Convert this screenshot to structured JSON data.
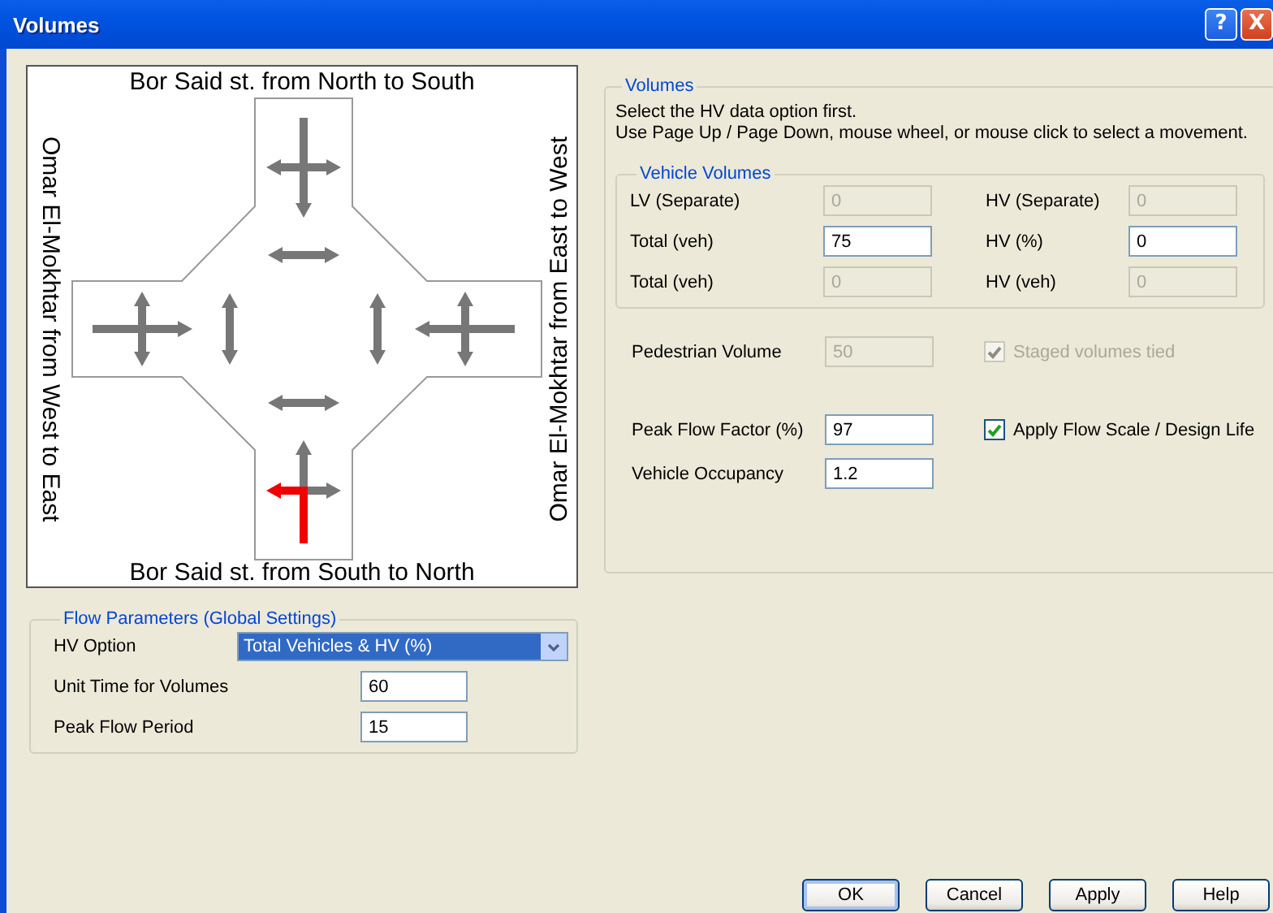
{
  "window": {
    "title": "Volumes",
    "help_button": "?",
    "close_button": "X"
  },
  "diagram": {
    "labels": {
      "top": "Bor Said st. from North to South",
      "bottom": "Bor Said st. from South to North",
      "left": "Omar El-Mokhtar from West to East",
      "right": "Omar El-Mokhtar from East to West"
    },
    "approaches": [
      {
        "kind": "north",
        "movements": [
          {
            "kind": "left",
            "selected": false
          },
          {
            "kind": "through",
            "selected": false
          },
          {
            "kind": "right",
            "selected": false
          }
        ]
      },
      {
        "kind": "west",
        "movements": [
          {
            "kind": "left",
            "selected": false
          },
          {
            "kind": "through",
            "selected": false
          },
          {
            "kind": "right",
            "selected": false
          }
        ]
      },
      {
        "kind": "east",
        "movements": [
          {
            "kind": "left",
            "selected": false
          },
          {
            "kind": "through",
            "selected": false
          },
          {
            "kind": "right",
            "selected": false
          }
        ]
      },
      {
        "kind": "south",
        "movements": [
          {
            "kind": "left",
            "selected": true
          },
          {
            "kind": "through",
            "selected": false
          },
          {
            "kind": "right",
            "selected": false
          }
        ]
      }
    ],
    "crosswalks": [
      {
        "kind": "north",
        "selected": false
      },
      {
        "kind": "west",
        "selected": false
      },
      {
        "kind": "east",
        "selected": false
      },
      {
        "kind": "south",
        "selected": false
      }
    ]
  },
  "volumes": {
    "legend": "Volumes",
    "instructions": [
      "Select the HV data option first.",
      "Use Page Up / Page Down, mouse wheel, or mouse click to select a movement."
    ],
    "vehicle_volumes": {
      "legend": "Vehicle Volumes",
      "fields": [
        {
          "label": "LV (Separate)",
          "value": "0",
          "disabled": true
        },
        {
          "label": "HV (Separate)",
          "value": "0",
          "disabled": true
        },
        {
          "label": "Total (veh)",
          "value": "75",
          "disabled": false
        },
        {
          "label": "HV (%)",
          "value": "0",
          "disabled": false
        },
        {
          "label": "Total (veh)",
          "value": "0",
          "disabled": true
        },
        {
          "label": "HV (veh)",
          "value": "0",
          "disabled": true
        }
      ]
    },
    "pedestrian": {
      "label": "Pedestrian Volume",
      "value": "50",
      "disabled": true
    },
    "staged_tied": {
      "label": "Staged volumes tied",
      "checked": true,
      "disabled": true
    },
    "peak_flow_factor": {
      "label": "Peak Flow Factor (%)",
      "value": "97",
      "disabled": false
    },
    "occupancy": {
      "label": "Vehicle Occupancy",
      "value": "1.2",
      "disabled": false
    },
    "apply_flow_scale": {
      "label": "Apply Flow Scale / Design Life",
      "checked": true,
      "disabled": false
    }
  },
  "flow_parameters": {
    "legend": "Flow Parameters (Global Settings)",
    "hv_option": {
      "label": "HV Option",
      "value": "Total Vehicles & HV (%)"
    },
    "fields": [
      {
        "label": "Unit Time for Volumes",
        "value": "60"
      },
      {
        "label": "Peak Flow Period",
        "value": "15"
      }
    ]
  },
  "buttons": [
    {
      "label": "OK",
      "default": true
    },
    {
      "label": "Cancel",
      "default": false
    },
    {
      "label": "Apply",
      "default": false
    },
    {
      "label": "Help",
      "default": false
    }
  ]
}
